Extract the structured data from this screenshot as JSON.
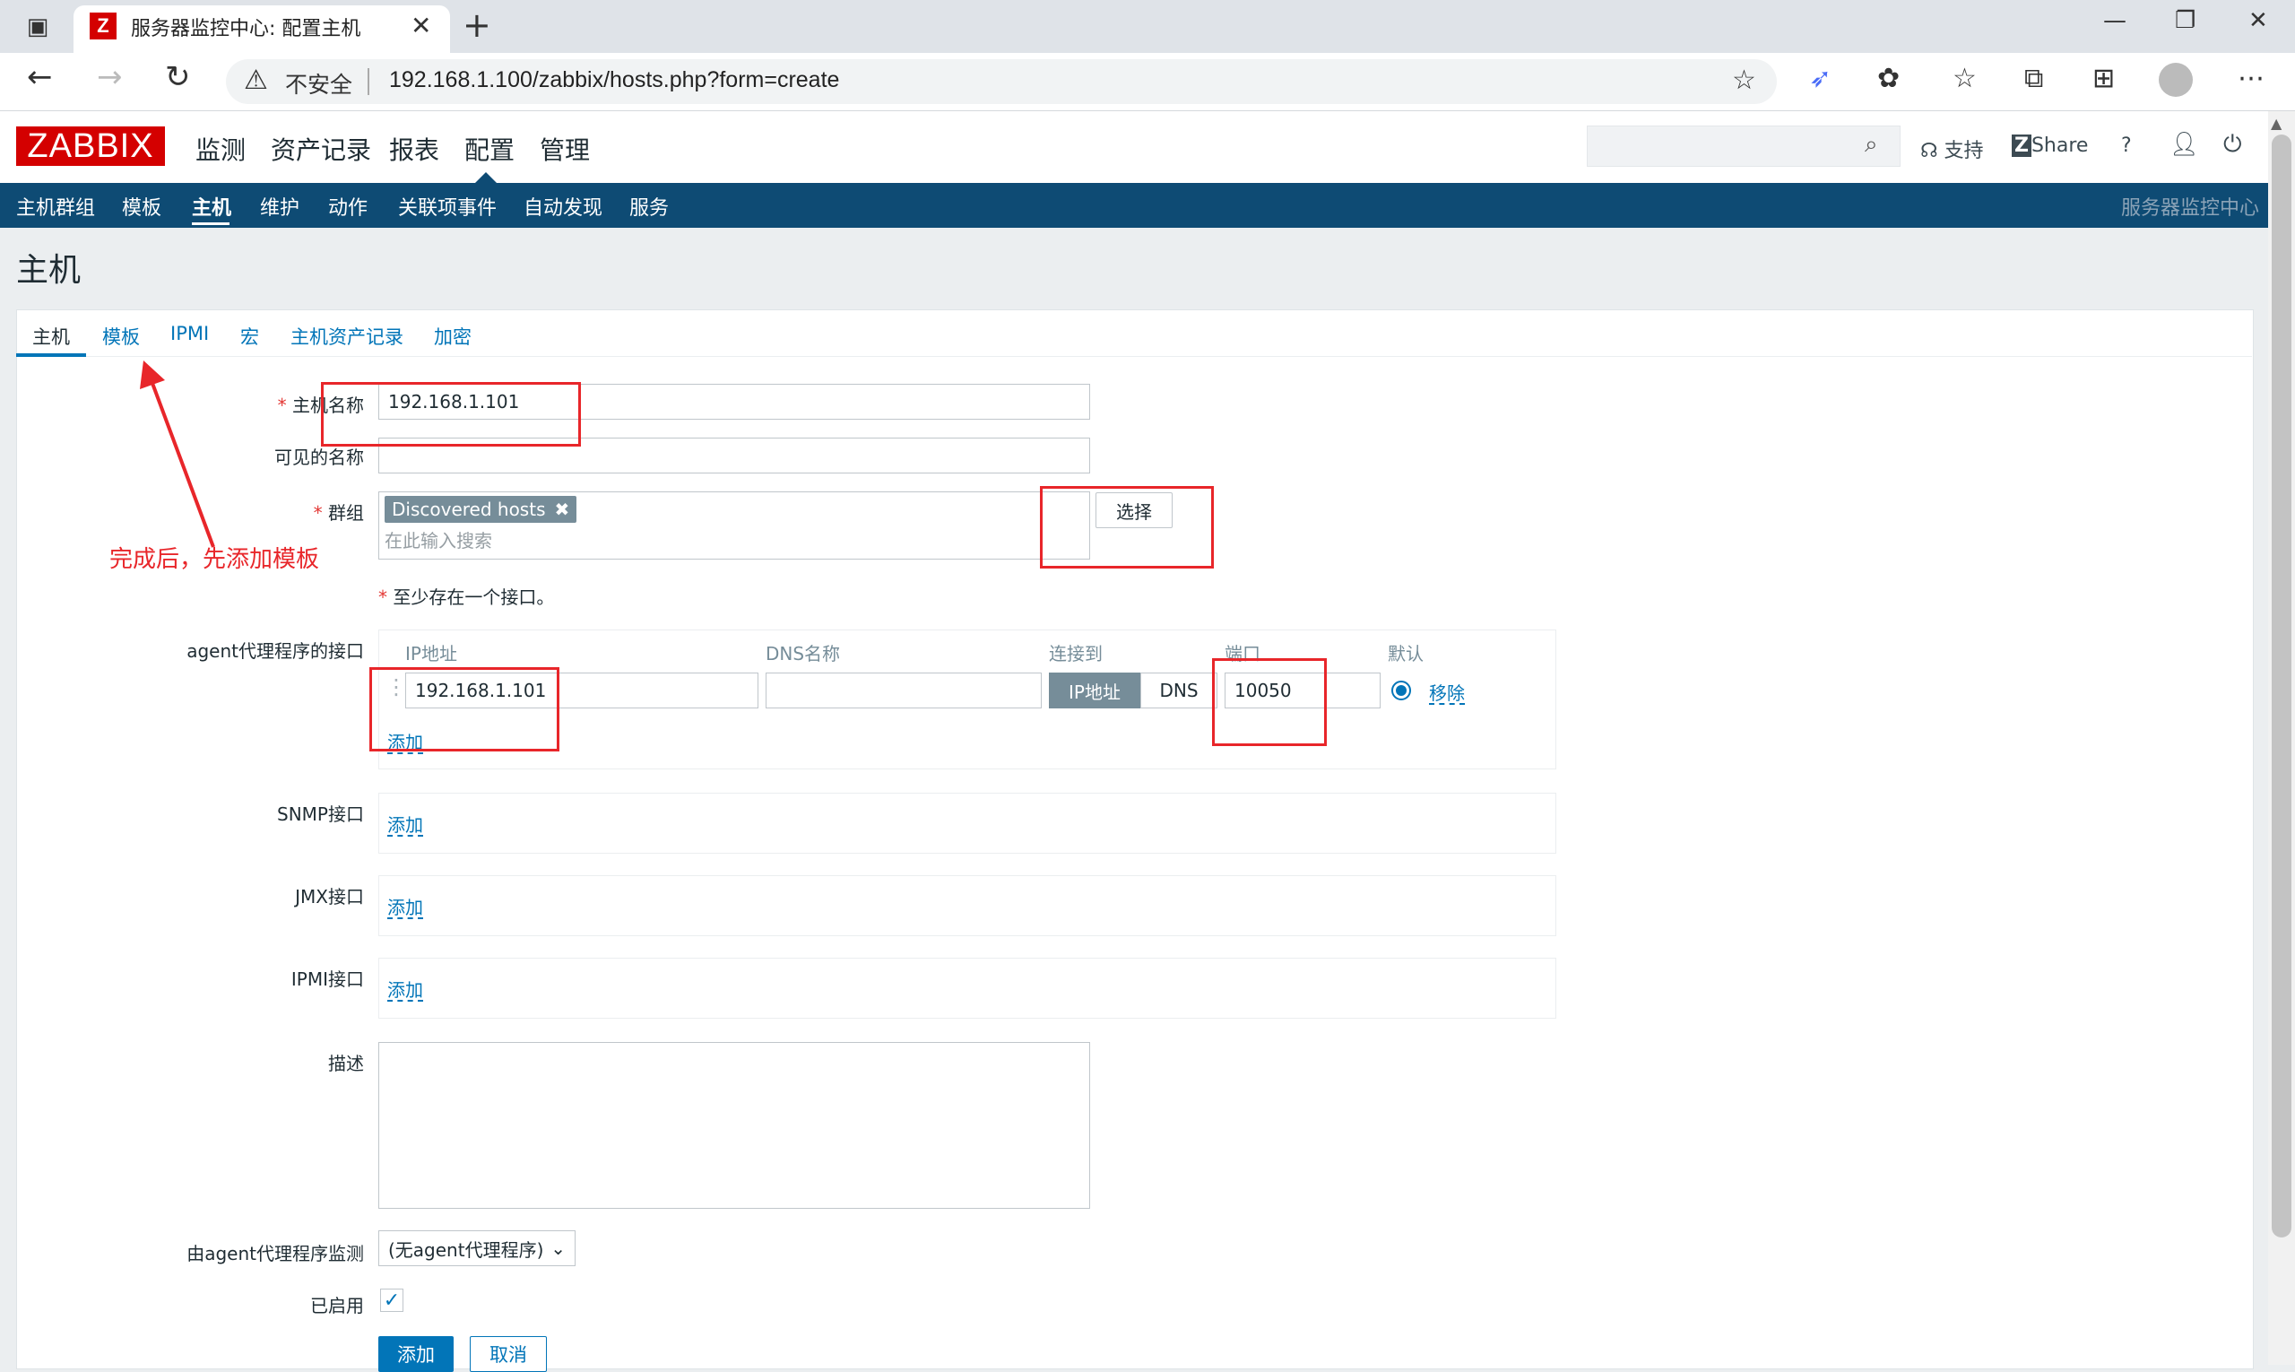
{
  "browser": {
    "tab_title": "服务器监控中心: 配置主机",
    "favicon_letter": "Z",
    "security_label": "不安全",
    "url": "192.168.1.100/zabbix/hosts.php?form=create"
  },
  "zabbix": {
    "logo": "ZABBIX",
    "top_menu": [
      "监测",
      "资产记录",
      "报表",
      "配置",
      "管理"
    ],
    "selected_top_menu": "配置",
    "header_links": {
      "support": "支持",
      "share": "Share",
      "help": "?"
    },
    "sub_menu": [
      "主机群组",
      "模板",
      "主机",
      "维护",
      "动作",
      "关联项事件",
      "自动发现",
      "服务"
    ],
    "selected_sub_menu": "主机",
    "server_name": "服务器监控中心"
  },
  "page": {
    "title": "主机",
    "form_tabs": [
      "主机",
      "模板",
      "IPMI",
      "宏",
      "主机资产记录",
      "加密"
    ],
    "selected_form_tab": "主机"
  },
  "form": {
    "host_name": {
      "label": "主机名称",
      "value": "192.168.1.101"
    },
    "visible_name": {
      "label": "可见的名称",
      "value": ""
    },
    "groups": {
      "label": "群组",
      "chips": [
        "Discovered hosts"
      ],
      "placeholder": "在此输入搜索",
      "select_button": "选择"
    },
    "interface_note": "至少存在一个接口。",
    "agent_interfaces": {
      "label": "agent代理程序的接口",
      "col_ip": "IP地址",
      "col_dns": "DNS名称",
      "col_connect": "连接到",
      "col_port": "端口",
      "col_default": "默认",
      "ip": "192.168.1.101",
      "dns": "",
      "connect_ip": "IP地址",
      "connect_dns": "DNS",
      "port": "10050",
      "remove": "移除",
      "add": "添加"
    },
    "snmp": {
      "label": "SNMP接口",
      "add": "添加"
    },
    "jmx": {
      "label": "JMX接口",
      "add": "添加"
    },
    "ipmi": {
      "label": "IPMI接口",
      "add": "添加"
    },
    "description": {
      "label": "描述",
      "value": ""
    },
    "proxy": {
      "label": "由agent代理程序监测",
      "value": "(无agent代理程序)"
    },
    "enabled": {
      "label": "已启用",
      "checked": true
    },
    "buttons": {
      "add": "添加",
      "cancel": "取消"
    }
  },
  "annotation": {
    "text": "完成后，先添加模板",
    "color": "#e8262a"
  },
  "colors": {
    "brand_red": "#d40000",
    "nav_blue": "#0e4b74",
    "link_blue": "#0275b8"
  }
}
